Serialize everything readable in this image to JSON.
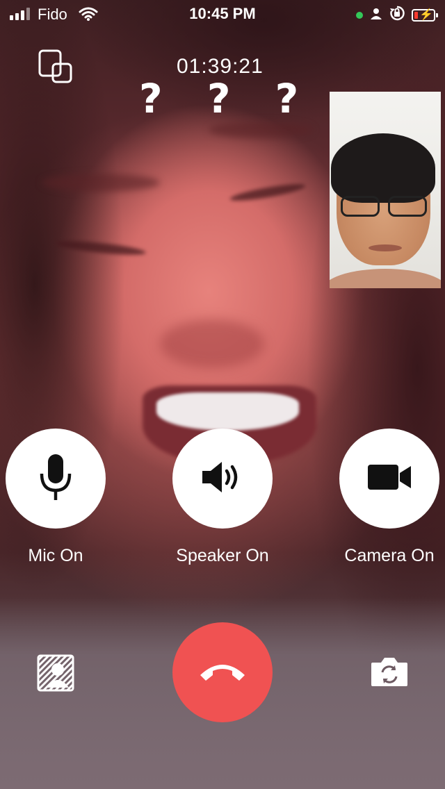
{
  "status_bar": {
    "carrier": "Fido",
    "time": "10:45 PM",
    "signal_bars": 3,
    "battery_level_percent": 10,
    "icons": [
      "signal-icon",
      "wifi-icon",
      "green-dot-indicator",
      "person-icon",
      "orientation-lock-icon",
      "battery-charging-icon"
    ]
  },
  "call": {
    "duration": "01:39:21",
    "overlay_text": "? ? ?"
  },
  "controls": {
    "mic_label": "Mic On",
    "speaker_label": "Speaker On",
    "camera_label": "Camera On"
  },
  "bottom_bar": {
    "icons": [
      "background-blur-icon",
      "end-call-icon",
      "switch-camera-icon"
    ]
  },
  "colors": {
    "end_call": "#f05252",
    "control_bg": "#ffffff",
    "battery_low": "#ff3b30",
    "active_dot": "#34c759"
  }
}
